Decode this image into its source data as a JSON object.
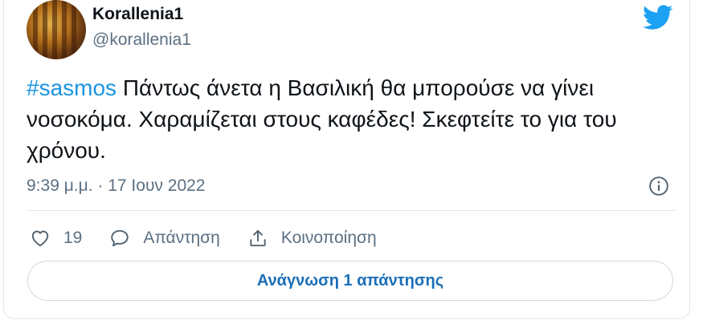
{
  "author": {
    "display_name": "Korallenia1",
    "handle": "@korallenia1"
  },
  "tweet": {
    "hashtag": "#sasmos",
    "text": " Πάντως άνετα η Βασιλική θα μπορούσε να γίνει νοσοκόμα. Χαραμίζεται στους καφέδες! Σκεφτείτε το για του χρόνου.",
    "timestamp": "9:39 μ.μ. · 17 Ιουν 2022"
  },
  "actions": {
    "like_count": "19",
    "reply_label": "Απάντηση",
    "share_label": "Κοινοποίηση"
  },
  "read_replies_label": "Ανάγνωση 1 απάντησης",
  "colors": {
    "accent": "#1b95e0",
    "secondary_text": "#5b7083",
    "twitter_blue": "#1da1f2",
    "button_text": "#1b6fb8"
  },
  "icons": {
    "brand": "twitter-bird-icon",
    "info": "info-icon",
    "like": "heart-icon",
    "reply": "speech-bubble-icon",
    "share": "share-arrow-icon"
  }
}
